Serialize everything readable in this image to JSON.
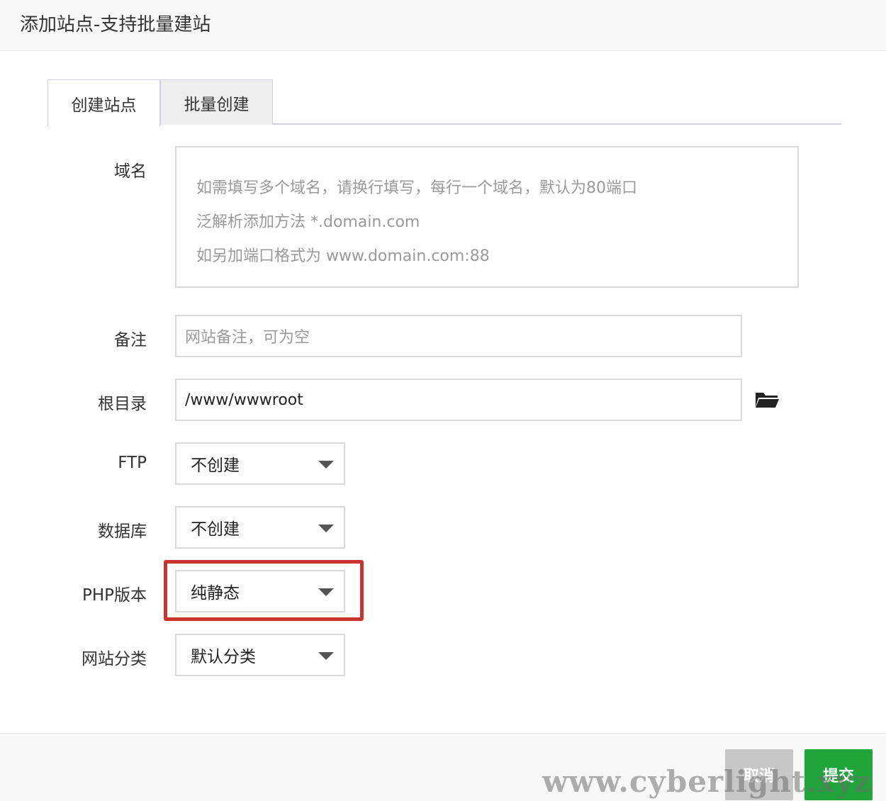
{
  "dialog": {
    "title": "添加站点-支持批量建站"
  },
  "tabs": [
    {
      "label": "创建站点",
      "active": true
    },
    {
      "label": "批量创建",
      "active": false
    }
  ],
  "form": {
    "domain": {
      "label": "域名",
      "placeholder_lines": [
        "如需填写多个域名，请换行填写，每行一个域名，默认为80端口",
        "泛解析添加方法 *.domain.com",
        "如另加端口格式为 www.domain.com:88"
      ]
    },
    "remark": {
      "label": "备注",
      "placeholder": "网站备注，可为空"
    },
    "root": {
      "label": "根目录",
      "value": "/www/wwwroot",
      "icon": "folder-open-icon"
    },
    "ftp": {
      "label": "FTP",
      "selected": "不创建"
    },
    "database": {
      "label": "数据库",
      "selected": "不创建"
    },
    "php": {
      "label": "PHP版本",
      "selected": "纯静态"
    },
    "category": {
      "label": "网站分类",
      "selected": "默认分类"
    }
  },
  "footer": {
    "cancel_label": "取消",
    "submit_label": "提交"
  },
  "watermark": "www.cyberlight.xyz",
  "colors": {
    "submit": "#20a53a",
    "cancel": "#c7c7c7",
    "highlight": "#c9342c"
  }
}
